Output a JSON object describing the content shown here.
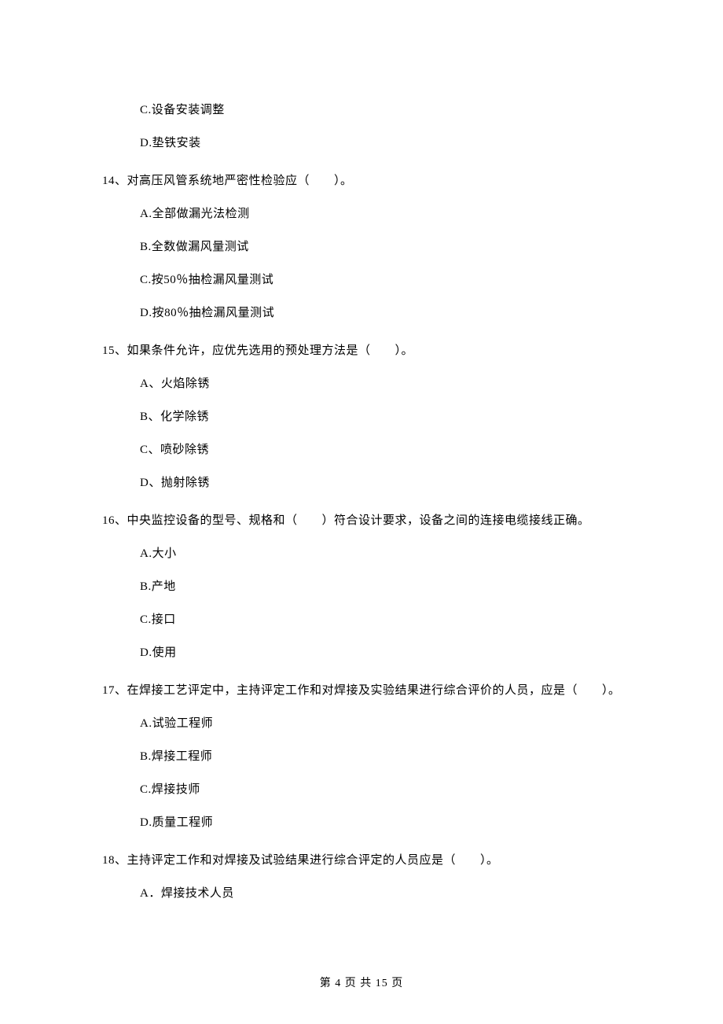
{
  "orphan_options": [
    "C.设备安装调整",
    "D.垫铁安装"
  ],
  "questions": [
    {
      "num": "14",
      "stem_pre": "14、对高压风管系统地严密性检验应（",
      "stem_post": "）。",
      "options": [
        "A.全部做漏光法检测",
        "B.全数做漏风量测试",
        "C.按50％抽检漏风量测试",
        "D.按80％抽检漏风量测试"
      ]
    },
    {
      "num": "15",
      "stem_pre": "15、如果条件允许，应优先选用的预处理方法是（",
      "stem_post": "）。",
      "options": [
        "A、火焰除锈",
        "B、化学除锈",
        "C、喷砂除锈",
        "D、抛射除锈"
      ]
    },
    {
      "num": "16",
      "stem_pre": "16、中央监控设备的型号、规格和（",
      "stem_post": "）符合设计要求，设备之间的连接电缆接线正确。",
      "options": [
        "A.大小",
        "B.产地",
        "C.接口",
        "D.使用"
      ]
    },
    {
      "num": "17",
      "stem_pre": "17、在焊接工艺评定中，主持评定工作和对焊接及实验结果进行综合评价的人员，应是（",
      "stem_post": "）。",
      "options": [
        "A.试验工程师",
        "B.焊接工程师",
        "C.焊接技师",
        "D.质量工程师"
      ]
    },
    {
      "num": "18",
      "stem_pre": "18、主持评定工作和对焊接及试验结果进行综合评定的人员应是（",
      "stem_post": "）。",
      "options": [
        "A．焊接技术人员"
      ]
    }
  ],
  "footer": "第 4 页 共 15 页"
}
